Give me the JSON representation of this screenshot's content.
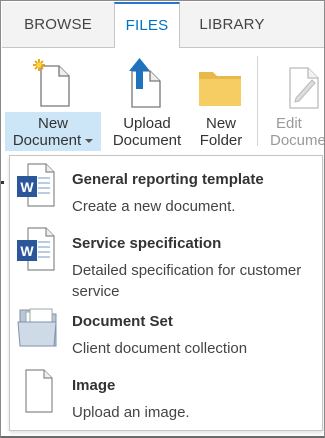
{
  "tabs": [
    {
      "label": "BROWSE"
    },
    {
      "label": "FILES"
    },
    {
      "label": "LIBRARY"
    }
  ],
  "ribbon": {
    "new_doc_line1": "New",
    "new_doc_line2": "Document",
    "upload_line1": "Upload",
    "upload_line2": "Document",
    "folder_line1": "New",
    "folder_line2": "Folder",
    "edit_line1": "Edit",
    "edit_line2": "Docume"
  },
  "menu": {
    "items": [
      {
        "title": "General reporting template",
        "desc": "Create a new document.",
        "icon": "word-doc-icon"
      },
      {
        "title": "Service specification",
        "desc": "Detailed specification for customer service",
        "icon": "word-doc-icon"
      },
      {
        "title": "Document Set",
        "desc": "Client document collection",
        "icon": "document-set-icon"
      },
      {
        "title": "Image",
        "desc": "Upload an image.",
        "icon": "blank-page-icon"
      }
    ]
  },
  "colors": {
    "accent": "#0072c6",
    "highlight": "#cde6f7",
    "word_blue": "#2b579a",
    "folder": "#f2c85b"
  }
}
